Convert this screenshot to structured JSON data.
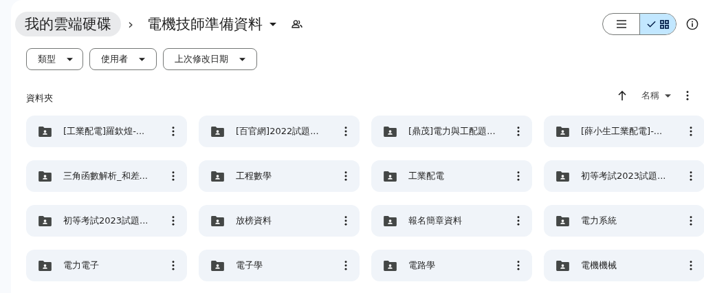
{
  "breadcrumb": {
    "root": "我的雲端硬碟",
    "separator": "›",
    "current": "電機技師準備資料"
  },
  "view_toggle": [
    {
      "kind": "list",
      "selected": false
    },
    {
      "kind": "grid",
      "selected": true
    }
  ],
  "filters": [
    "類型",
    "使用者",
    "上次修改日期"
  ],
  "section_title": "資料夾",
  "sort": {
    "label": "名稱"
  },
  "folders": [
    "[工業配電]羅欽煌-...",
    "[百官網]2022試題...",
    "[鼎茂]電力與工配題...",
    "[薛小生工業配電]-...",
    "三角函數解析_和差...",
    "工程數學",
    "工業配電",
    "初等考試2023試題...",
    "初等考試2023試題...",
    "放榜資料",
    "報名簡章資料",
    "電力系統",
    "電力電子",
    "電子學",
    "電路學",
    "電機機械"
  ]
}
